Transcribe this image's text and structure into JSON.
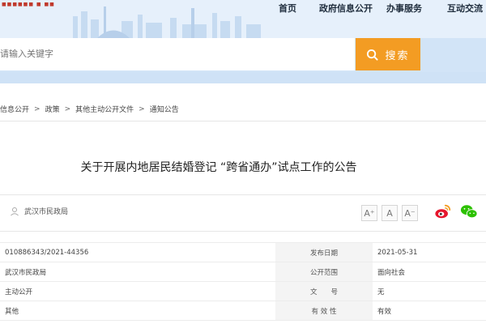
{
  "header": {
    "brand_text": "■■■■■■ ■ ■■",
    "nav": [
      {
        "label": "首页"
      },
      {
        "label": "政府信息公开"
      },
      {
        "label": "办事服务"
      },
      {
        "label": "互动交流"
      }
    ],
    "search": {
      "placeholder": "请输入关键字",
      "button_label": "搜索"
    }
  },
  "breadcrumb": [
    "信息公开",
    "政策",
    "其他主动公开文件",
    "通知公告"
  ],
  "article": {
    "title": "关于开展内地居民结婚登记 “跨省通办”试点工作的公告",
    "publisher": "武汉市民政局",
    "font_buttons": [
      "A⁺",
      "A",
      "A⁻"
    ]
  },
  "meta_table": [
    {
      "left": "010886343/2021-44356",
      "label": "发布日期",
      "right": "2021-05-31"
    },
    {
      "left": "武汉市民政局",
      "label": "公开范围",
      "right": "面向社会"
    },
    {
      "left": "主动公开",
      "label": "文　　号",
      "right": "无"
    },
    {
      "left": "其他",
      "label": "有 效 性",
      "right": "有效"
    }
  ],
  "colors": {
    "accent": "#f39c23",
    "header_bg": "#dcebfa",
    "weibo": "#e6162d",
    "wechat": "#2dc100"
  }
}
